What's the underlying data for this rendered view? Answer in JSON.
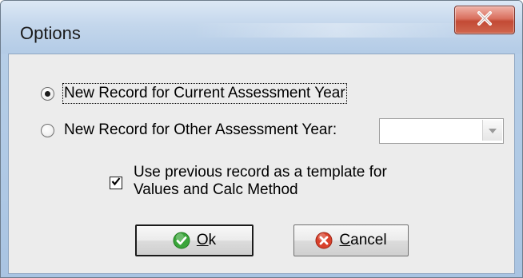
{
  "window": {
    "title": "Options"
  },
  "options": {
    "radio_current": {
      "label": "New Record for Current Assessment Year",
      "checked": true
    },
    "radio_other": {
      "label": "New Record for Other Assessment Year:",
      "checked": false
    },
    "year_combo": {
      "value": ""
    },
    "template_checkbox": {
      "label_line1": "Use previous record as a template for",
      "label_line2": "Values and Calc Method",
      "checked": true
    }
  },
  "buttons": {
    "ok": {
      "mnemonic": "O",
      "rest": "k"
    },
    "cancel": {
      "mnemonic": "C",
      "rest": "ancel"
    }
  },
  "icons": {
    "close": "close-icon",
    "ok": "green-check-icon",
    "cancel": "red-x-icon",
    "dropdown": "chevron-down-icon"
  },
  "colors": {
    "ok_icon": "#3aa53a",
    "cancel_icon": "#d9412b",
    "close_button": "#c24a35"
  }
}
